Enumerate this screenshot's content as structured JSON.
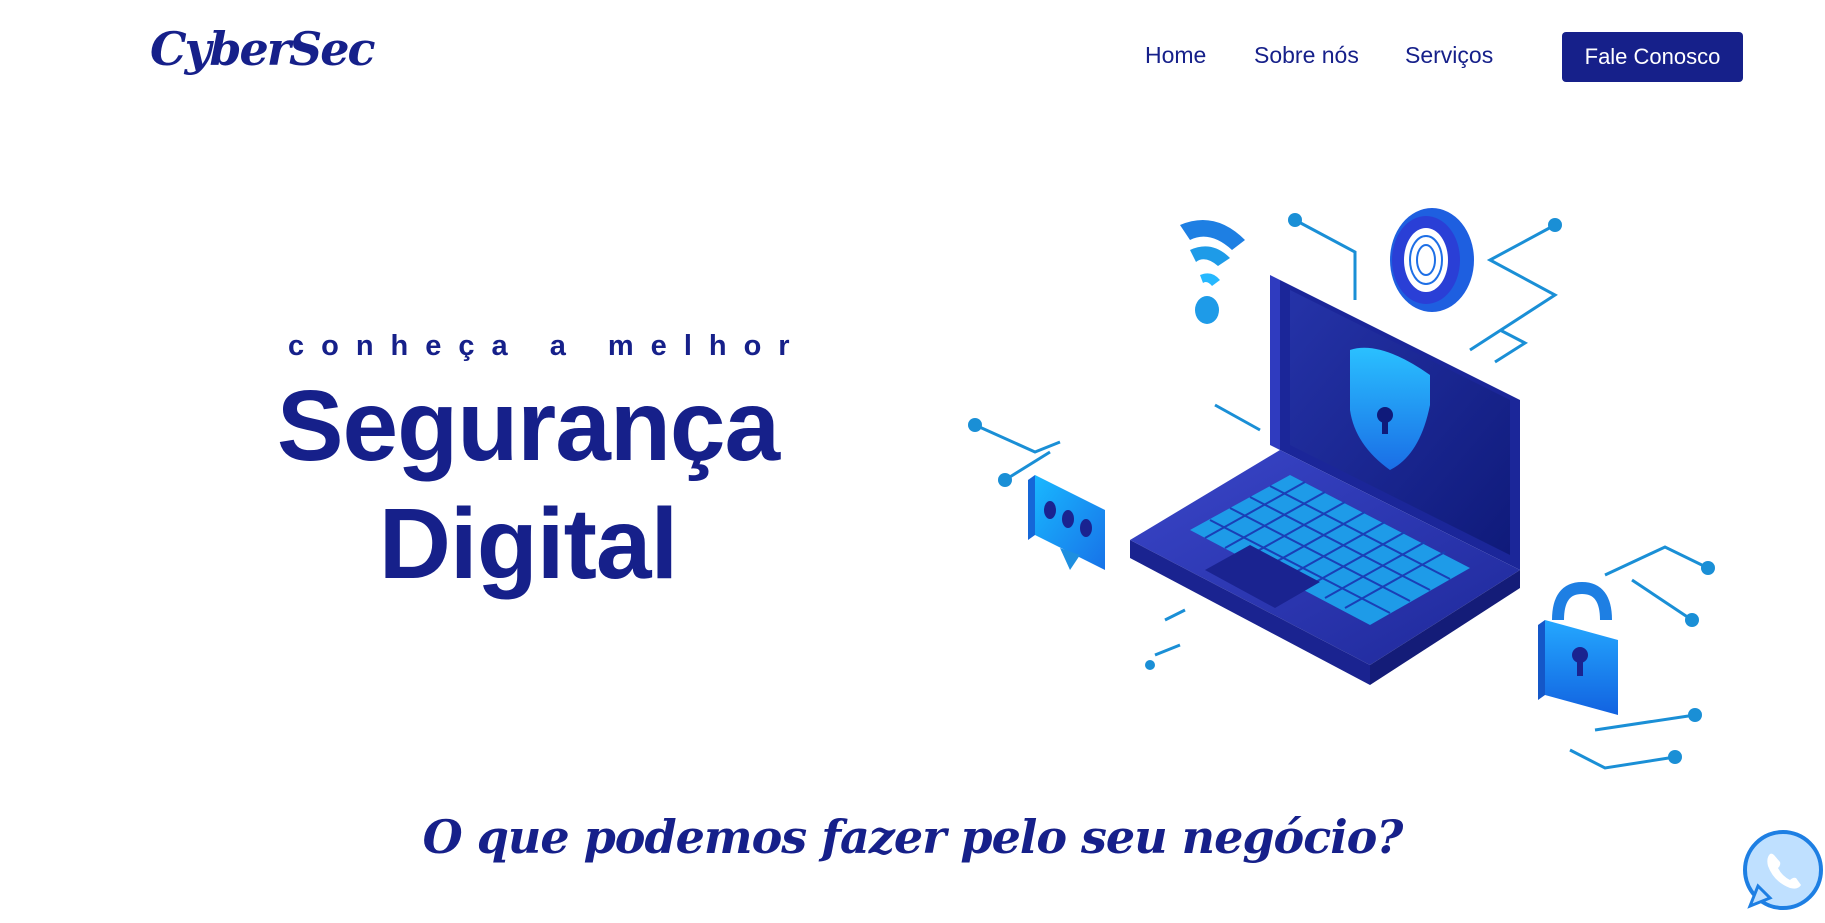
{
  "brand": {
    "logo_text": "CyberSec"
  },
  "nav": {
    "home": "Home",
    "about": "Sobre nós",
    "services": "Serviços",
    "cta": "Fale Conosco"
  },
  "hero": {
    "kicker": "conheça a melhor",
    "headline_line1": "Segurança",
    "headline_line2": "Digital"
  },
  "section": {
    "heading": "O que podemos fazer pelo seu negócio?"
  },
  "icons": {
    "illustration": "cybersecurity-laptop-illustration",
    "whatsapp": "whatsapp-icon"
  },
  "colors": {
    "brand": "#16208a",
    "accent": "#1e8fe0",
    "white": "#ffffff"
  }
}
